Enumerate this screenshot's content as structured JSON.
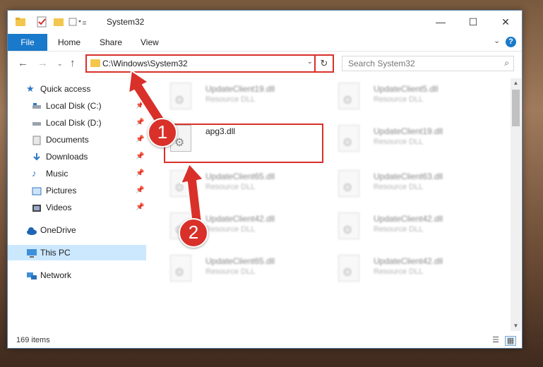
{
  "window": {
    "title": "System32"
  },
  "ribbon": {
    "tabs": [
      "File",
      "Home",
      "Share",
      "View"
    ],
    "help": "?"
  },
  "address": {
    "path": "C:\\Windows\\System32"
  },
  "search": {
    "placeholder": "Search System32"
  },
  "sidebar": {
    "items": [
      {
        "label": "Quick access",
        "icon": "star-icon",
        "pinned": false
      },
      {
        "label": "Local Disk (C:)",
        "icon": "drive-icon",
        "pinned": true
      },
      {
        "label": "Local Disk (D:)",
        "icon": "drive-icon",
        "pinned": true
      },
      {
        "label": "Documents",
        "icon": "documents-icon",
        "pinned": true
      },
      {
        "label": "Downloads",
        "icon": "download-icon",
        "pinned": true
      },
      {
        "label": "Music",
        "icon": "music-icon",
        "pinned": true
      },
      {
        "label": "Pictures",
        "icon": "pictures-icon",
        "pinned": true
      },
      {
        "label": "Videos",
        "icon": "videos-icon",
        "pinned": true
      },
      {
        "label": "OneDrive",
        "icon": "cloud-icon",
        "pinned": false
      },
      {
        "label": "This PC",
        "icon": "computer-icon",
        "pinned": false,
        "selected": true
      },
      {
        "label": "Network",
        "icon": "network-icon",
        "pinned": false
      }
    ]
  },
  "files": {
    "left": [
      {
        "name": "UpdateClient19.dll",
        "type": "Resource DLL",
        "blurred": true
      },
      {
        "name": "apg3.dll",
        "type": "",
        "blurred": false
      },
      {
        "name": "UpdateClient65.dll",
        "type": "Resource DLL",
        "blurred": true
      },
      {
        "name": "UpdateClient42.dll",
        "type": "Resource DLL",
        "blurred": true
      },
      {
        "name": "UpdateClient65.dll",
        "type": "Resource DLL",
        "blurred": true
      }
    ],
    "right": [
      {
        "name": "UpdateClient5.dll",
        "type": "Resource DLL",
        "blurred": true
      },
      {
        "name": "UpdateClient19.dll",
        "type": "Resource DLL",
        "blurred": true
      },
      {
        "name": "UpdateClient63.dll",
        "type": "Resource DLL",
        "blurred": true
      },
      {
        "name": "UpdateClient42.dll",
        "type": "Resource DLL",
        "blurred": true
      },
      {
        "name": "UpdateClient42.dll",
        "type": "Resource DLL",
        "blurred": true
      }
    ]
  },
  "status": {
    "count": "169 items"
  },
  "annotations": {
    "step1": "1",
    "step2": "2",
    "color": "#d9302a"
  }
}
